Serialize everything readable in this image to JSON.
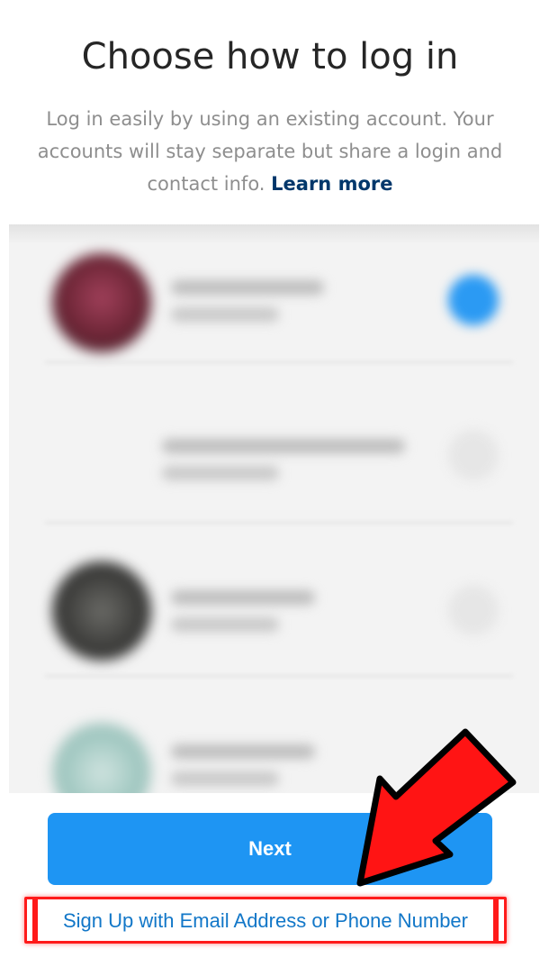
{
  "page": {
    "title": "Choose how to log in",
    "subtitle": "Log in easily by using an existing account. Your accounts will stay separate but share a login and contact info.",
    "learn_more_label": "Learn more"
  },
  "accounts_panel": {
    "note": "",
    "rows": [
      {
        "avatar_color": "#7a2a3a",
        "selected": true
      },
      {
        "avatar_color": "none",
        "selected": false
      },
      {
        "avatar_color": "#3a3a3a",
        "selected": false
      },
      {
        "avatar_color": "#9fc7c0",
        "selected": false
      }
    ]
  },
  "actions": {
    "next_label": "Next",
    "signup_label": "Sign Up with Email Address or Phone Number"
  },
  "colors": {
    "primary": "#1e95f3",
    "link_dark": "#00376b",
    "annotation": "#ff1a1a"
  }
}
